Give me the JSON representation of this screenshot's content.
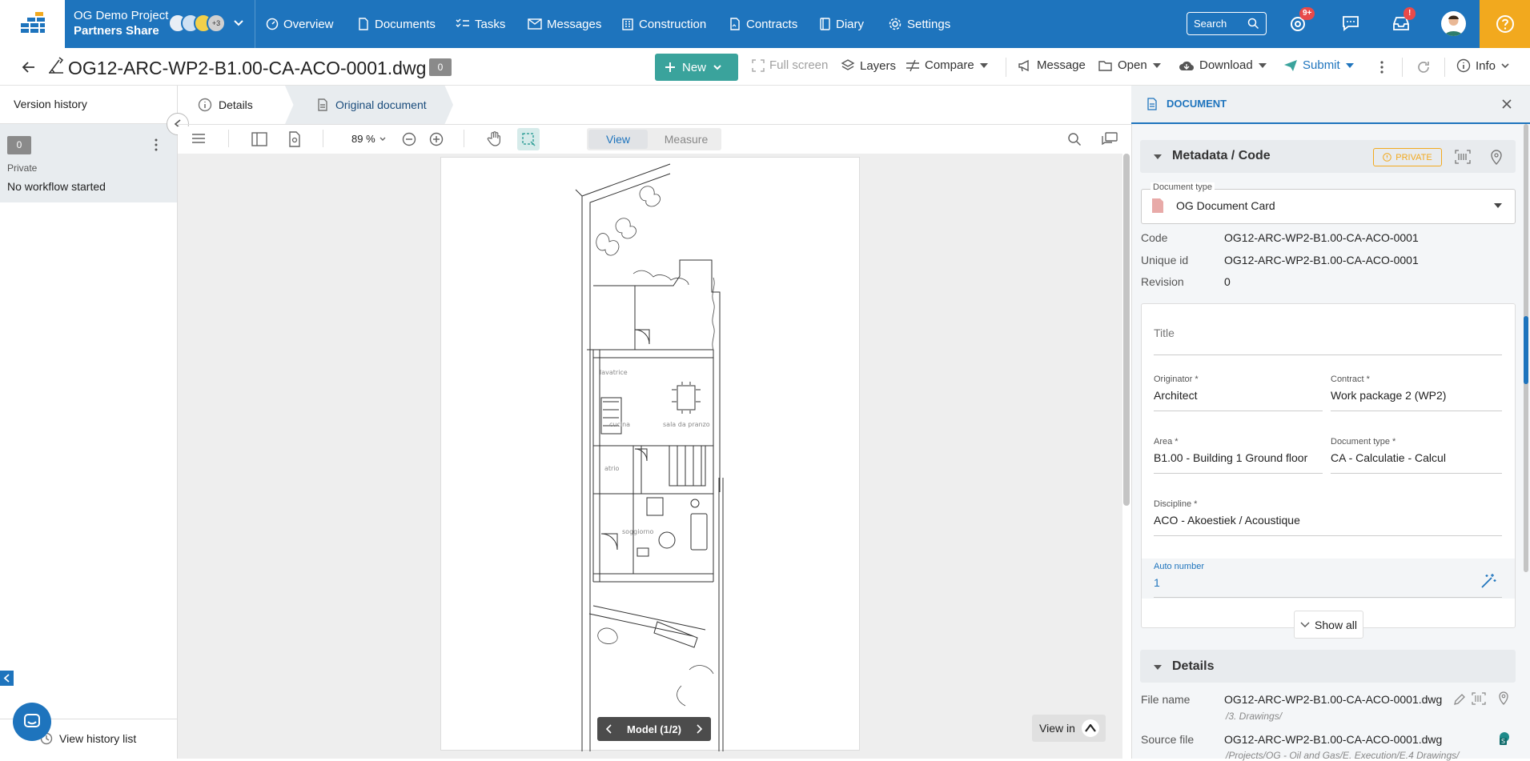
{
  "colors": {
    "primary": "#1e74bd",
    "accent": "#3aa39c",
    "warning": "#f2a91e",
    "badge": "#e84a4a"
  },
  "header": {
    "project_name": "OG Demo Project",
    "project_share": "Partners Share",
    "avatars_more": "+3",
    "nav": [
      {
        "label": "Overview",
        "icon": "gauge-icon"
      },
      {
        "label": "Documents",
        "icon": "document-icon"
      },
      {
        "label": "Tasks",
        "icon": "checklist-icon"
      },
      {
        "label": "Messages",
        "icon": "envelope-icon"
      },
      {
        "label": "Construction",
        "icon": "building-icon"
      },
      {
        "label": "Contracts",
        "icon": "contract-icon"
      },
      {
        "label": "Diary",
        "icon": "book-icon"
      },
      {
        "label": "Settings",
        "icon": "gear-icon"
      }
    ],
    "search_label": "Search",
    "mentions_badge": "9+",
    "notifications_badge": "!"
  },
  "toolbar": {
    "filename": "OG12-ARC-WP2-B1.00-CA-ACO-0001.dwg",
    "version": "0",
    "new_label": "New",
    "fullscreen_label": "Full screen",
    "layers_label": "Layers",
    "compare_label": "Compare",
    "message_label": "Message",
    "open_label": "Open",
    "download_label": "Download",
    "submit_label": "Submit",
    "info_label": "Info"
  },
  "left_panel": {
    "title": "Version history",
    "version_num": "0",
    "visibility": "Private",
    "workflow": "No workflow started",
    "footer_label": "View history list"
  },
  "tabs": {
    "details": "Details",
    "original": "Original document"
  },
  "viewer": {
    "zoom": "89 %",
    "view_label": "View",
    "measure_label": "Measure",
    "model_label": "Model (1/2)",
    "view_in_label": "View in",
    "room_labels": [
      "lavatrice",
      "cucina",
      "sala da pranzo",
      "atrio",
      "soggiorno"
    ]
  },
  "right_panel": {
    "header": "DOCUMENT",
    "metadata_title": "Metadata / Code",
    "private_badge": "PRIVATE",
    "doctype_label": "Document type",
    "doctype_value": "OG Document Card",
    "code_label": "Code",
    "code_value": "OG12-ARC-WP2-B1.00-CA-ACO-0001",
    "uid_label": "Unique id",
    "uid_value": "OG12-ARC-WP2-B1.00-CA-ACO-0001",
    "rev_label": "Revision",
    "rev_value": "0",
    "title_placeholder": "Title",
    "originator_label": "Originator *",
    "originator_value": "Architect",
    "contract_label": "Contract *",
    "contract_value": "Work package 2 (WP2)",
    "area_label": "Area *",
    "area_value": "B1.00 - Building 1 Ground floor",
    "doctype2_label": "Document type *",
    "doctype2_value": "CA - Calculatie - Calcul",
    "discipline_label": "Discipline *",
    "discipline_value": "ACO - Akoestiek / Acoustique",
    "autonumber_label": "Auto number",
    "autonumber_value": "1",
    "show_all": "Show all",
    "details_title": "Details",
    "file_name_label": "File name",
    "file_name_value": "OG12-ARC-WP2-B1.00-CA-ACO-0001.dwg",
    "file_name_path": "/3. Drawings/",
    "source_file_label": "Source file",
    "source_file_value": "OG12-ARC-WP2-B1.00-CA-ACO-0001.dwg",
    "source_file_path": "/Projects/OG - Oil and Gas/E. Execution/E.4 Drawings/"
  }
}
